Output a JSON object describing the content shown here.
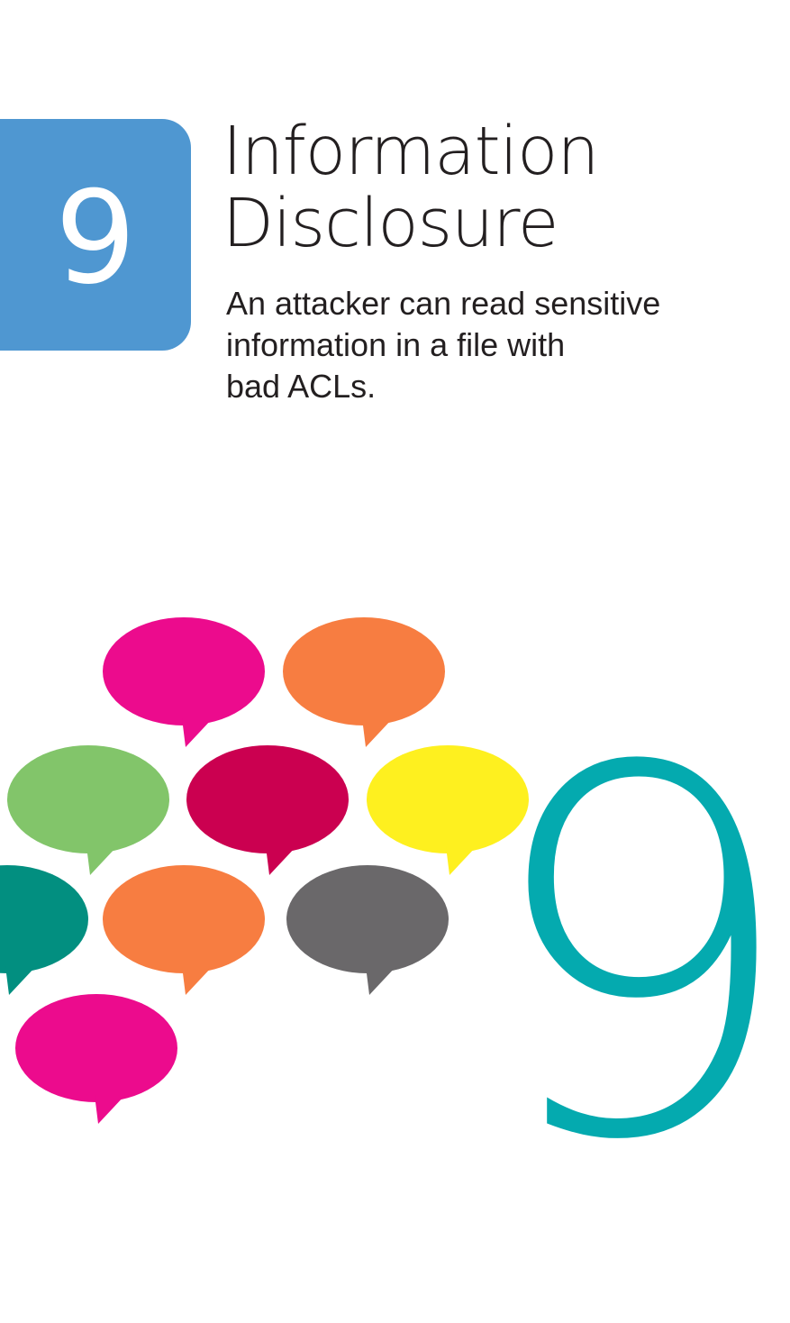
{
  "card": {
    "number": "9",
    "title_lines": [
      "Information",
      "Disclosure"
    ],
    "description_lines": [
      "An attacker can read sensitive",
      "information in a file with",
      "bad ACLs."
    ],
    "large_number": "9"
  },
  "colors": {
    "badge": "#4f97d1",
    "large_number": "#04aaaf",
    "text": "#231f20"
  },
  "speech_bubbles": [
    {
      "color": "#ec0b8d",
      "icon": "speech-bubble-icon"
    },
    {
      "color": "#f77d41",
      "icon": "speech-bubble-icon"
    },
    {
      "color": "#82c56a",
      "icon": "speech-bubble-icon"
    },
    {
      "color": "#cb0050",
      "icon": "speech-bubble-icon"
    },
    {
      "color": "#fef01f",
      "icon": "speech-bubble-icon"
    },
    {
      "color": "#028f80",
      "icon": "speech-bubble-icon"
    },
    {
      "color": "#f77d41",
      "icon": "speech-bubble-icon"
    },
    {
      "color": "#6a686a",
      "icon": "speech-bubble-icon"
    },
    {
      "color": "#ec0b8d",
      "icon": "speech-bubble-icon"
    }
  ]
}
